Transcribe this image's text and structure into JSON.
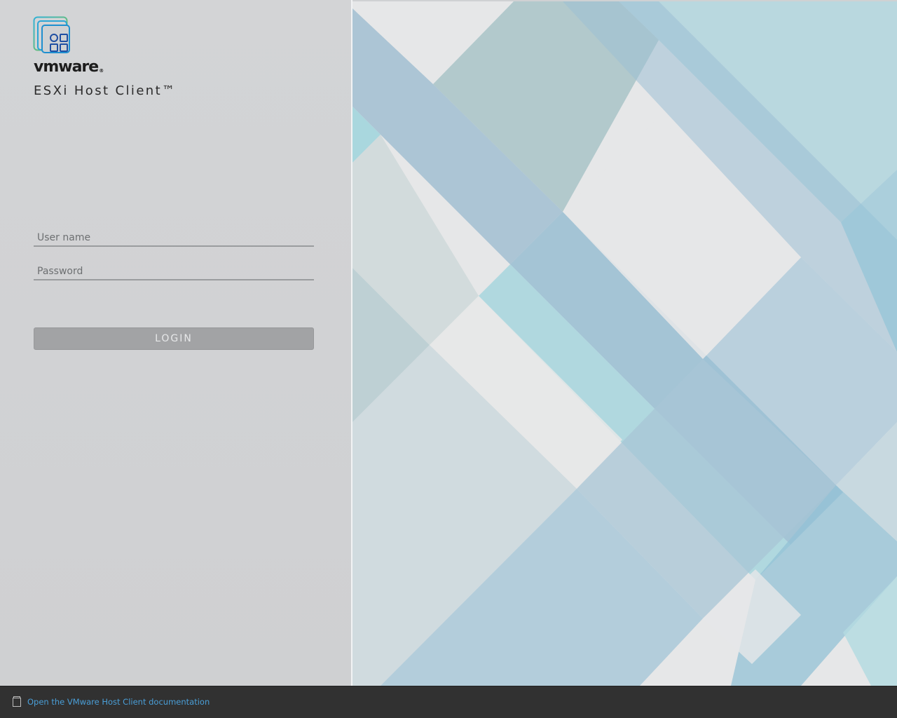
{
  "brand": {
    "wordmark": "vmware",
    "registered_mark": "®",
    "product_title": "ESXi Host Client™"
  },
  "login_form": {
    "username_placeholder": "User name",
    "password_placeholder": "Password",
    "login_label": "LOGIN"
  },
  "footer": {
    "doc_icon": "document-icon",
    "doc_link_text": "Open the VMware Host Client documentation"
  },
  "colors": {
    "panel_background": "#d2d3d5",
    "login_button": "#a2a3a5",
    "footer_background": "#313131",
    "link": "#4a9fd8",
    "art_light_blue": "#9fc6d9",
    "art_teal": "#a8d6dc"
  }
}
